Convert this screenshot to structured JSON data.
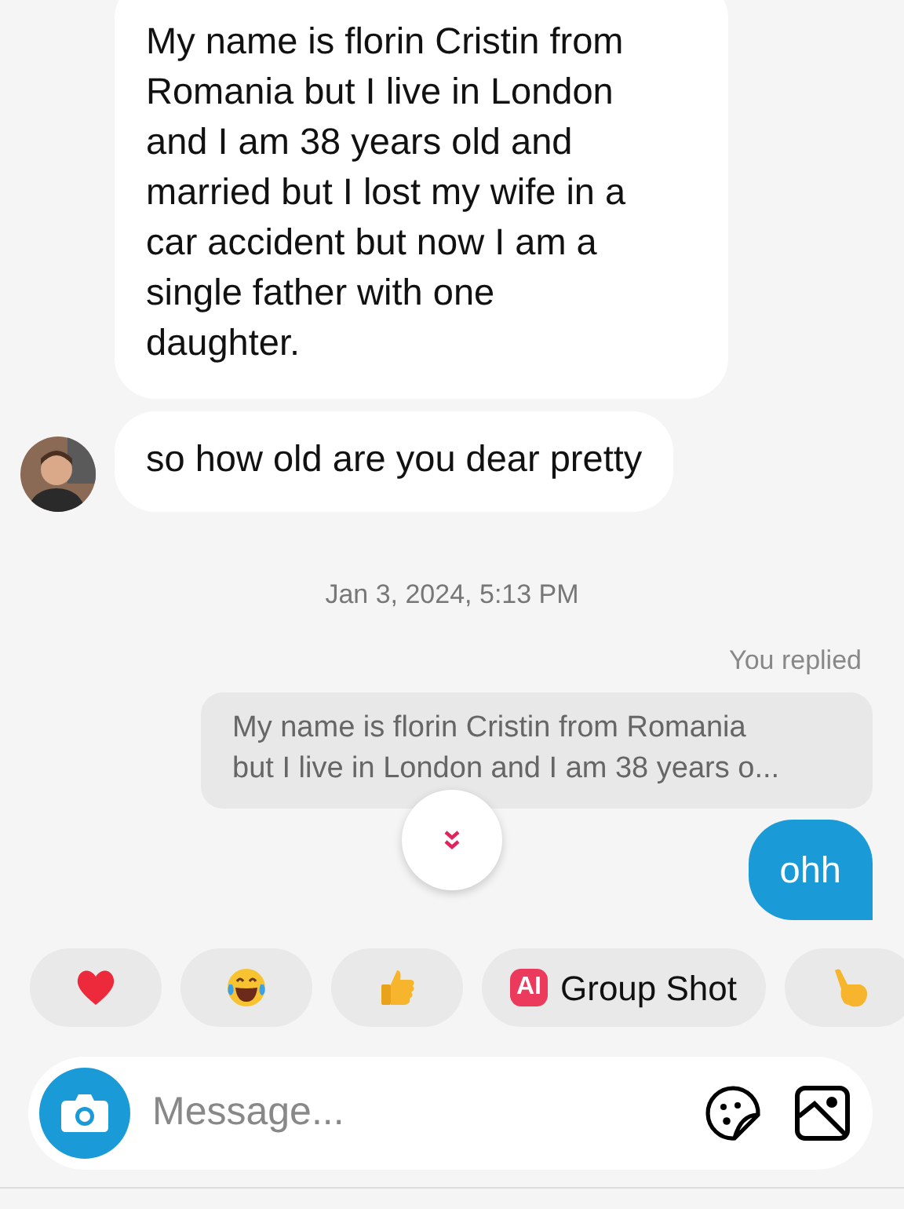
{
  "messages": [
    {
      "kind": "incoming",
      "text": "My name is florin Cristin from Romania but I live in London and I am 38 years old and married but I lost my wife in a car accident but now I am a single father with one daughter.",
      "avatar": false
    },
    {
      "kind": "incoming",
      "text": "so how old are you dear pretty",
      "avatar": true
    }
  ],
  "timestamp": "Jan 3, 2024, 5:13 PM",
  "reply": {
    "label": "You replied",
    "quoted": "My name is florin Cristin from Romania but I live in London and I am 38 years o...",
    "text": "ohh"
  },
  "quick_replies": [
    {
      "kind": "heart"
    },
    {
      "kind": "laugh"
    },
    {
      "kind": "thumbs"
    },
    {
      "kind": "ai",
      "badge": "AI",
      "label": "Group Shot"
    },
    {
      "kind": "pointing"
    }
  ],
  "composer": {
    "placeholder": "Message..."
  }
}
